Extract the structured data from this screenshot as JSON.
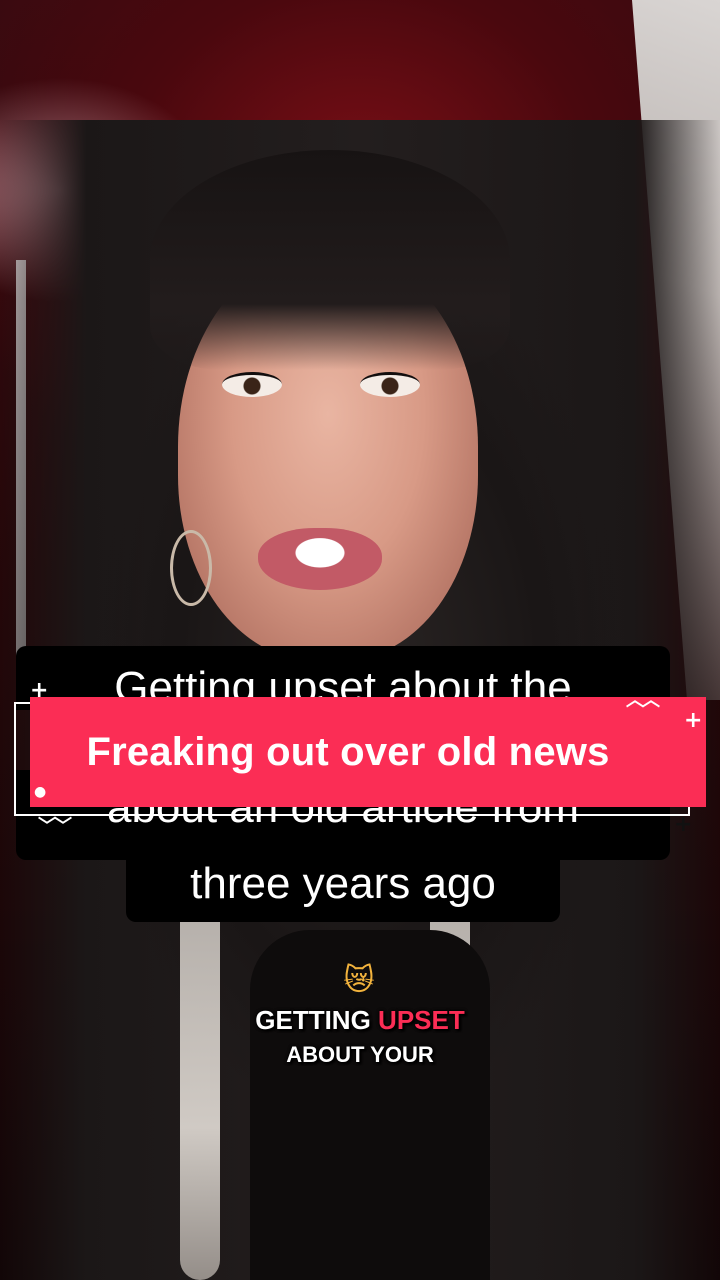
{
  "video": {
    "background_description_colors": {
      "backdrop": "#7a0f16",
      "hair": "#1b1717",
      "skin": "#d89a86"
    }
  },
  "captions": {
    "line1": "Getting upset about the",
    "line2": "about an old article from",
    "line3": "three years ago"
  },
  "hook": {
    "text": "Freaking out over old news",
    "color": "#fb2d55"
  },
  "sub_caption": {
    "emoji": "😿",
    "word1": "GETTING",
    "word2": "UPSET",
    "line2": "ABOUT YOUR"
  }
}
